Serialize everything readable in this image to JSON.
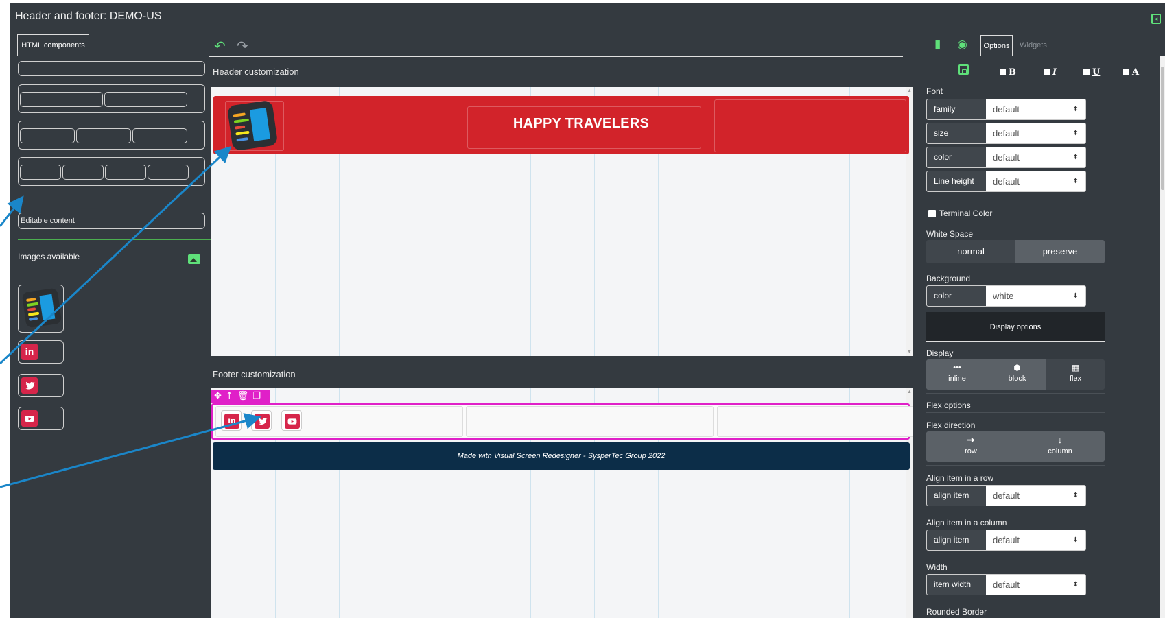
{
  "window": {
    "title": "Header and footer: DEMO-US"
  },
  "left_panel": {
    "tab_label": "HTML components",
    "editable_label": "Editable content",
    "images_label": "Images available",
    "social_images": [
      "in",
      "Twitter",
      "YouTube"
    ]
  },
  "center": {
    "header_label": "Header customization",
    "footer_label": "Footer customization",
    "banner_title": "HAPPY TRAVELERS",
    "footer_text": "Made with Visual Screen Redesigner - SysperTec Group 2022",
    "footer_icons": [
      "in",
      "Twitter",
      "YouTube"
    ]
  },
  "right_panel": {
    "tabs": [
      "Options",
      "Widgets"
    ],
    "format_buttons": [
      "B",
      "I",
      "U",
      "A"
    ],
    "font_label": "Font",
    "font_rows": [
      {
        "label": "family",
        "value": "default"
      },
      {
        "label": "size",
        "value": "default"
      },
      {
        "label": "color",
        "value": "default"
      },
      {
        "label": "Line height",
        "value": "default"
      }
    ],
    "terminal_color": "Terminal Color",
    "white_space_label": "White Space",
    "white_space_options": [
      "normal",
      "preserve"
    ],
    "background_label": "Background",
    "background_color": {
      "label": "color",
      "value": "white"
    },
    "display_options": "Display options",
    "display_label": "Display",
    "display_modes": [
      "inline",
      "block",
      "flex"
    ],
    "flex_options": "Flex options",
    "flex_direction_label": "Flex direction",
    "flex_directions": [
      "row",
      "column"
    ],
    "align_row_label": "Align item in a row",
    "align_row": {
      "label": "align item",
      "value": "default"
    },
    "align_col_label": "Align item in a column",
    "align_col": {
      "label": "align item",
      "value": "default"
    },
    "width_label": "Width",
    "width_row": {
      "label": "item width",
      "value": "default"
    },
    "rounded_border": "Rounded Border"
  },
  "colors": {
    "banner_red": "#d2232a",
    "accent_green": "#5fe07a",
    "selection_magenta": "#e020c8",
    "footer_navy": "#0c2d48"
  }
}
